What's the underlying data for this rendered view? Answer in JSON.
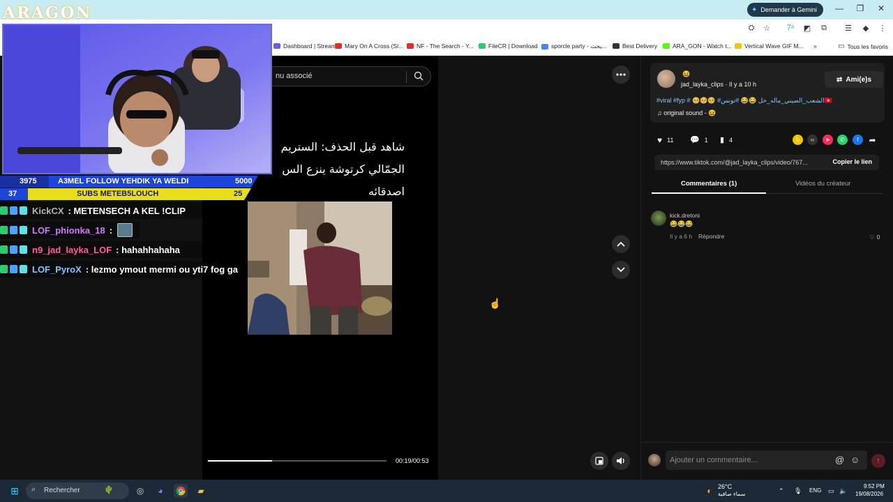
{
  "browser": {
    "gemini_label": "Demander à Gemini",
    "bookmarks": [
      {
        "label": "Dashboard | Stream...",
        "color": "#6c5ce7"
      },
      {
        "label": "Mary On A Cross (Sl...",
        "color": "#e52d27"
      },
      {
        "label": "NF - The Search - Y...",
        "color": "#e52d27"
      },
      {
        "label": "FileCR | Download",
        "color": "#2ecc71"
      },
      {
        "label": "sporcle party - بحث...",
        "color": "#4285f4"
      },
      {
        "label": "Best Delivery",
        "color": "#333333"
      },
      {
        "label": "ARA_GON - Watch t...",
        "color": "#53fc18"
      },
      {
        "label": "Vertical Wave GIF M...",
        "color": "#f1c40f"
      }
    ],
    "all_bookmarks": "Tous les favoris"
  },
  "stream": {
    "logo": "ARAGON",
    "goals": {
      "left_top": "3975",
      "left_bottom": "37",
      "title_top": "A3MEL FOLLOW YEHDIK YA WELDI",
      "title_bottom": "SUBS METEB5LOUCH",
      "right_top": "5000",
      "right_bottom": "25"
    },
    "chat": [
      {
        "user": "KickCX",
        "user_color": "#b6b6b6",
        "msg": ": METENSECH A KEL !CLIP"
      },
      {
        "user": "LOF_phionka_18",
        "user_color": "#d07cf3",
        "msg": ":"
      },
      {
        "user": "n9_jad_layka_LOF",
        "user_color": "#ff5fa2",
        "msg": ": hahahhahaha"
      },
      {
        "user": "LOF_PyroX",
        "user_color": "#7cc7ff",
        "msg": ": lezmo ymout mermi ou yti7 fog ga"
      }
    ]
  },
  "video": {
    "search_placeholder": "nu associé",
    "caption_lines": [
      "شاهد قبل الحذف: الستريم",
      "الجمّالي كرتوشة ينزع الس",
      "اصدقائه"
    ],
    "time": "00:19/00:53",
    "progress": 0.36
  },
  "post": {
    "author": "jad_layka_clips · Il y a 10 h",
    "friends_label": "Ami(e)s",
    "hashtags": "#viral #fyp # 🥺🥺🥺 #الشعب_الصيني_ماله_حل 😂😂 #تونس🇹🇳",
    "sound": "original sound - 😆",
    "likes": "11",
    "comments": "1",
    "saves": "4",
    "url": "https://www.tiktok.com/@jad_layka_clips/video/767...",
    "copy_label": "Copier le lien",
    "tab_comments": "Commentaires (1)",
    "tab_videos": "Vidéos du créateur"
  },
  "comment": {
    "user": "kick.dretoni",
    "text": "😂😂😂",
    "time": "Il y a 6 h",
    "reply": "Répondre",
    "likes": "0",
    "input_placeholder": "Ajouter un commentaire..."
  },
  "taskbar": {
    "search": "Rechercher",
    "temp": "26°C",
    "weather": "سماء صافية",
    "lang": "ENG",
    "clock": "9:52 PM",
    "date": "19/08/2026"
  }
}
